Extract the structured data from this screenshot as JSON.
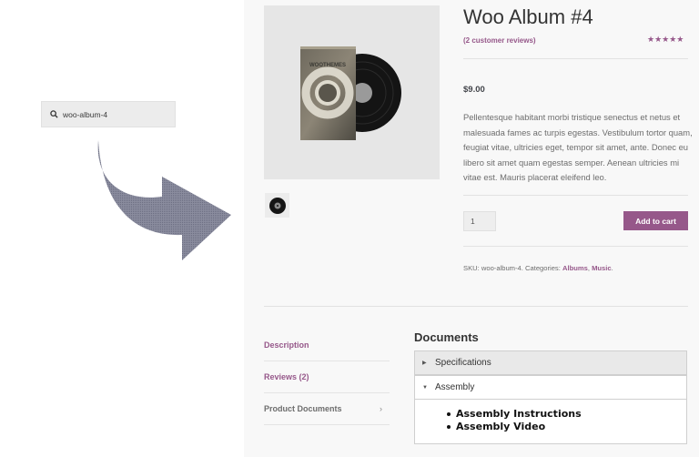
{
  "search": {
    "value": "woo-album-4"
  },
  "product": {
    "title": "Woo Album #4",
    "reviews_link": "(2 customer reviews)",
    "rating_stars": "★★★★★",
    "price": "$9.00",
    "description": "Pellentesque habitant morbi tristique senectus et netus et malesuada fames ac turpis egestas. Vestibulum tortor quam, feugiat vitae, ultricies eget, tempor sit amet, ante. Donec eu libero sit amet quam egestas semper. Aenean ultricies mi vitae est. Mauris placerat eleifend leo.",
    "quantity": "1",
    "add_to_cart": "Add to cart",
    "album_text": "WOOTHEMES",
    "meta": {
      "sku_label": "SKU:",
      "sku": "woo-album-4.",
      "categories_label": "Categories:",
      "categories": [
        "Albums",
        "Music"
      ],
      "sep": ",",
      "end": "."
    }
  },
  "tabs": [
    {
      "label": "Description"
    },
    {
      "label": "Reviews (2)"
    },
    {
      "label": "Product Documents",
      "chevron": "›"
    }
  ],
  "documents": {
    "heading": "Documents",
    "sections": [
      {
        "label": "Specifications",
        "collapsed_marker": "▶"
      },
      {
        "label": "Assembly",
        "expanded_marker": "▼",
        "items": [
          "Assembly Instructions",
          "Assembly Video"
        ]
      }
    ]
  },
  "colors": {
    "accent": "#96588a",
    "panel": "#f8f8f8",
    "arrow": "#7a7c8f"
  }
}
